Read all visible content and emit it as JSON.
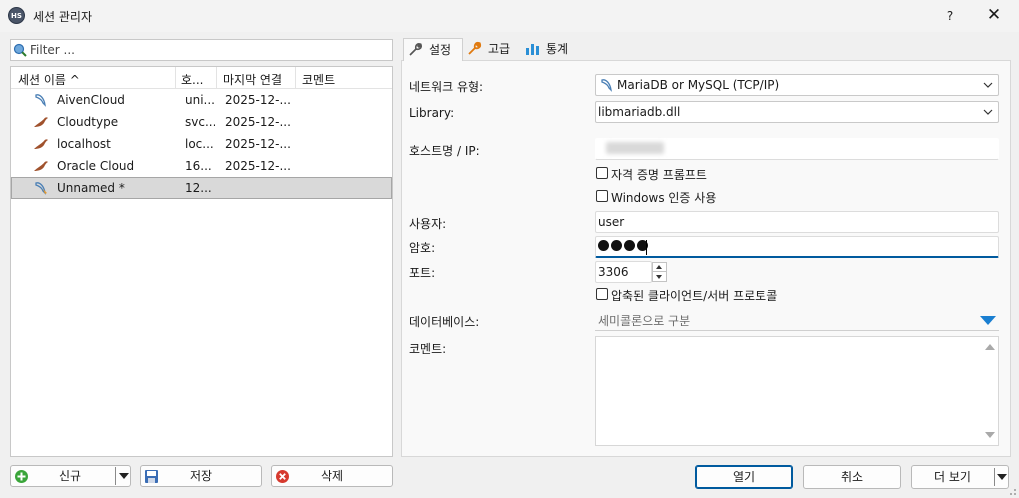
{
  "window": {
    "title": "세션 관리자",
    "app_icon_text": "HS",
    "help_label": "?",
    "close_label": "✕"
  },
  "filter": {
    "placeholder": "Filter ..."
  },
  "session_list": {
    "columns": [
      "세션 이름 ^",
      "호...",
      "마지막 연결",
      "코멘트"
    ],
    "rows": [
      {
        "name": "AivenCloud",
        "host": "uni...",
        "last": "2025-12-...",
        "comment": "",
        "icon": "mysql-dolphin-icon"
      },
      {
        "name": "Cloudtype",
        "host": "svc...",
        "last": "2025-12-...",
        "comment": "",
        "icon": "mariadb-seal-icon"
      },
      {
        "name": "localhost",
        "host": "loc...",
        "last": "2025-12-...",
        "comment": "",
        "icon": "mariadb-seal-icon"
      },
      {
        "name": "Oracle Cloud",
        "host": "16...",
        "last": "2025-12-...",
        "comment": "",
        "icon": "mariadb-seal-icon"
      },
      {
        "name": "Unnamed *",
        "host": "12...",
        "last": "",
        "comment": "",
        "icon": "mysql-dolphin-icon",
        "selected": true
      }
    ]
  },
  "left_buttons": {
    "new": "신규",
    "save": "저장",
    "delete": "삭제"
  },
  "tabs": [
    {
      "label": "설정",
      "icon": "wrench-icon",
      "active": true
    },
    {
      "label": "고급",
      "icon": "wrench-orange-icon",
      "active": false
    },
    {
      "label": "통계",
      "icon": "bar-chart-icon",
      "active": false
    }
  ],
  "form": {
    "network_type_label": "네트워크 유형:",
    "network_type_value": "MariaDB or MySQL (TCP/IP)",
    "library_label": "Library:",
    "library_value": "libmariadb.dll",
    "host_label": "호스트명 / IP:",
    "credential_prompt_label": "자격 증명 프롬프트",
    "windows_auth_label": "Windows 인증 사용",
    "user_label": "사용자:",
    "user_value": "user",
    "password_label": "암호:",
    "password_dots": 4,
    "port_label": "포트:",
    "port_value": "3306",
    "compressed_label": "압축된 클라이언트/서버 프로토콜",
    "database_label": "데이터베이스:",
    "database_placeholder": "세미콜론으로 구분",
    "comment_label": "코멘트:"
  },
  "dialog_buttons": {
    "open": "열기",
    "cancel": "취소",
    "more": "더 보기"
  },
  "colors": {
    "accent": "#005a9e",
    "db_arrow": "#1a7fd1",
    "selection": "#d9d9d9"
  }
}
